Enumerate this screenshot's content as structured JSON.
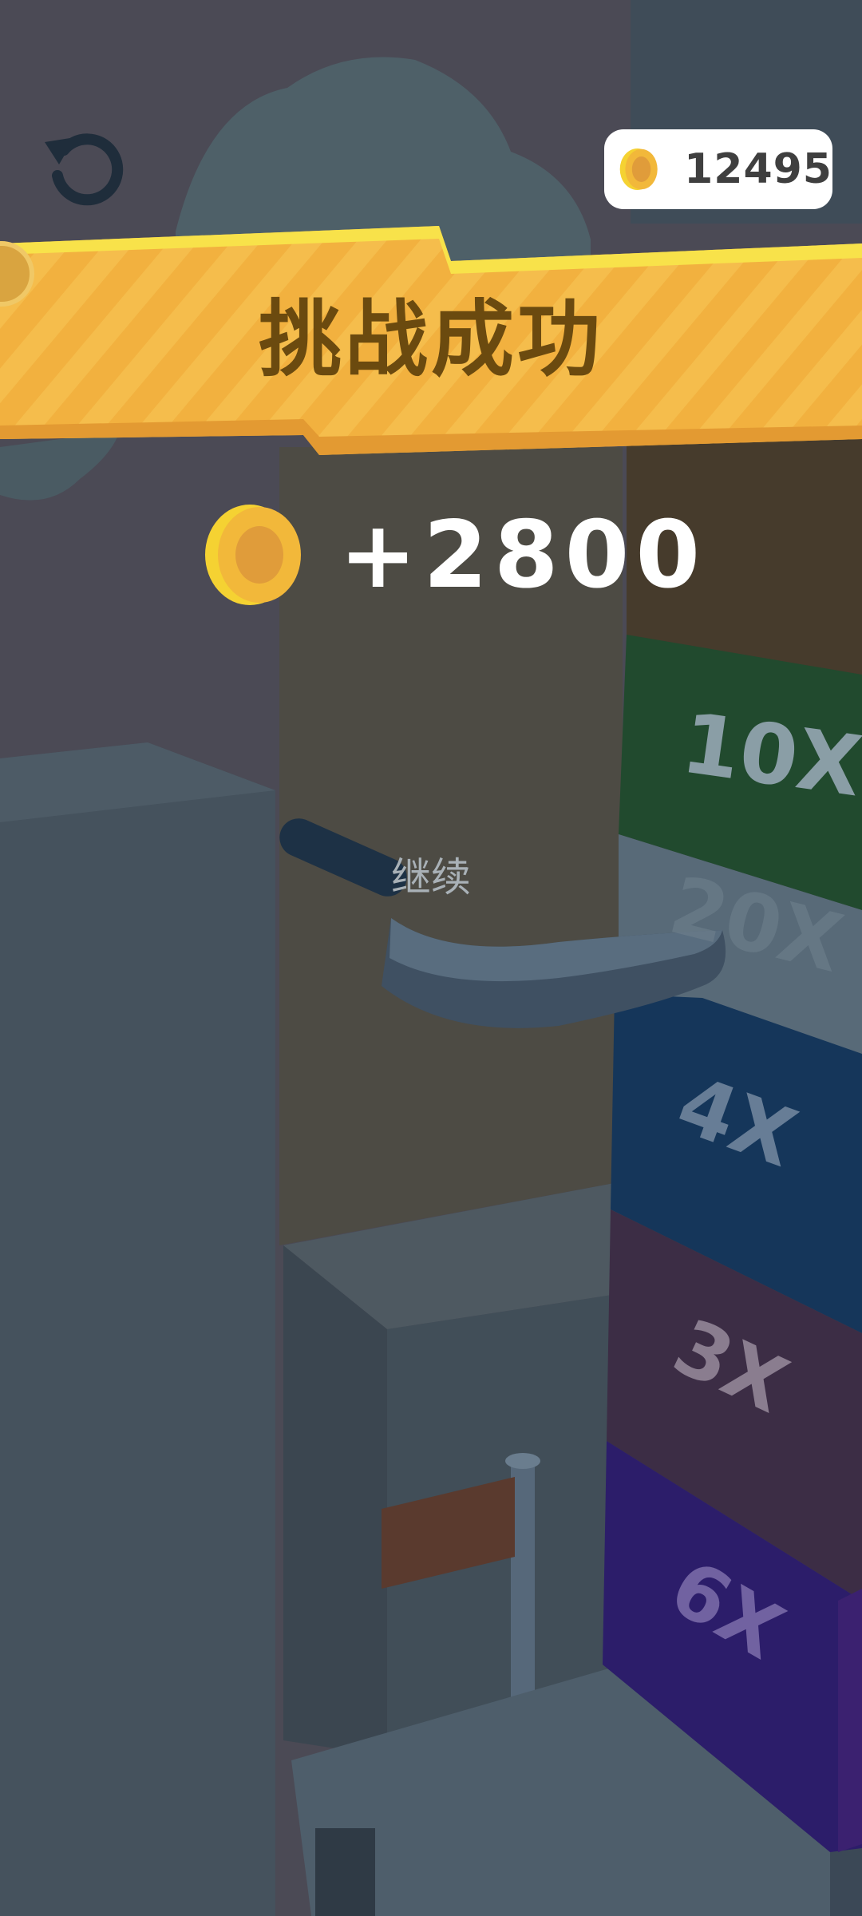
{
  "hud": {
    "coin_count": "12495",
    "colors": {
      "coin": "#f5c842",
      "coin_inner": "#e09c3a",
      "pill": "#ffffff"
    }
  },
  "result": {
    "title": "挑战成功",
    "reward": "+2800",
    "continue_label": "继续"
  },
  "tower": {
    "blocks": [
      {
        "label": "10X",
        "color": "#214a2e"
      },
      {
        "label": "20X",
        "color": "#586a78"
      },
      {
        "label": "4X",
        "color": "#15365a"
      },
      {
        "label": "3X",
        "color": "#3c2d45"
      },
      {
        "label": "6X",
        "color": "#2c1d6a"
      }
    ]
  },
  "icons": [
    "restart-icon",
    "coin-icon"
  ]
}
